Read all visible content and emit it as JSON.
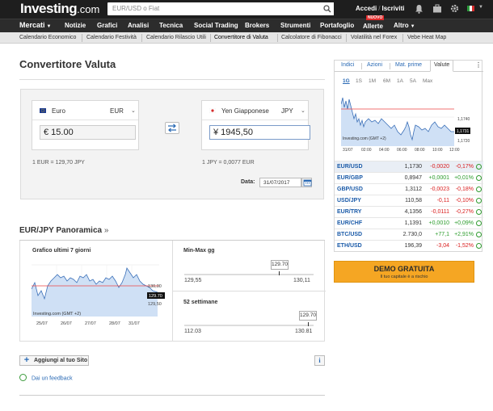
{
  "topbar": {
    "logo_main": "Investing",
    "logo_suffix": ".com",
    "search_placeholder": "EUR/USD o Fiat",
    "login": "Accedi",
    "separator": "/",
    "signup": "Iscriviti"
  },
  "nav": {
    "items": [
      "Mercati",
      "Notizie",
      "Grafici",
      "Analisi",
      "Tecnica",
      "Social Trading",
      "Brokers",
      "Strumenti",
      "Portafoglio",
      "Allerte",
      "Altro"
    ],
    "new_badge": "NUOVO"
  },
  "subnav": {
    "items": [
      "Calendario Economico",
      "Calendario Festività",
      "Calendario Rilascio Utili",
      "Convertitore di Valuta",
      "Calcolatore di Fibonacci",
      "Volatilità nel Forex",
      "Vebe Heat Map"
    ]
  },
  "converter": {
    "title": "Convertitore Valuta",
    "from": {
      "name": "Euro",
      "code": "EUR",
      "value": "€ 15.00",
      "rate": "1 EUR = 129,70 JPY"
    },
    "to": {
      "name": "Yen Giapponese",
      "code": "JPY",
      "value": "¥ 1945,50",
      "rate": "1 JPY = 0,0077 EUR"
    },
    "date_label": "Data:",
    "date_value": "31/07/2017"
  },
  "panoramica": {
    "title": "EUR/JPY Panoramica",
    "arrow": "»",
    "chart_label": "Grafico ultimi 7 giorni",
    "chart_source": "Investing.com (GMT +2)",
    "chart_y_labels": [
      "130,00",
      "129,70",
      "129,50"
    ],
    "chart_x_labels": [
      "25/07",
      "26/07",
      "27/07",
      "28/07",
      "31/07"
    ],
    "current_badge": "129.70",
    "minmax_label": "Min-Max gg",
    "minmax_current": "129.70",
    "minmax_low": "129,55",
    "minmax_high": "130,11",
    "week52_label": "52 settimane",
    "week52_current": "129.70",
    "week52_low": "112.03",
    "week52_high": "130.81"
  },
  "actions": {
    "add_site": "Aggiungi al tuo Sito",
    "info": "i",
    "feedback": "Dai un feedback"
  },
  "sidebar": {
    "tabs": [
      "Indici",
      "Azioni",
      "Mat. prime",
      "Valute"
    ],
    "periods": [
      "1G",
      "1S",
      "1M",
      "6M",
      "1A",
      "5A",
      "Max"
    ],
    "chart_source": "Investing.com (GMT +2)",
    "chart_y_labels": [
      "1,1740",
      "1,1731",
      "1,1720"
    ],
    "chart_x_labels": [
      "31/07",
      "02:00",
      "04:00",
      "06:00",
      "08:00",
      "10:00",
      "12:00"
    ],
    "quotes": [
      {
        "pair": "EUR/USD",
        "price": "1,1730",
        "change": "-0,0020",
        "pct": "-0,17%",
        "dir": "neg"
      },
      {
        "pair": "EUR/GBP",
        "price": "0,8947",
        "change": "+0,0001",
        "pct": "+0,01%",
        "dir": "pos"
      },
      {
        "pair": "GBP/USD",
        "price": "1,3112",
        "change": "-0,0023",
        "pct": "-0,18%",
        "dir": "neg"
      },
      {
        "pair": "USD/JPY",
        "price": "110,58",
        "change": "-0,11",
        "pct": "-0,10%",
        "dir": "neg"
      },
      {
        "pair": "EUR/TRY",
        "price": "4,1356",
        "change": "-0,0111",
        "pct": "-0,27%",
        "dir": "neg"
      },
      {
        "pair": "EUR/CHF",
        "price": "1,1391",
        "change": "+0,0010",
        "pct": "+0,09%",
        "dir": "pos"
      },
      {
        "pair": "BTC/USD",
        "price": "2.730,0",
        "change": "+77,1",
        "pct": "+2,91%",
        "dir": "pos"
      },
      {
        "pair": "ETH/USD",
        "price": "196,39",
        "change": "-3,04",
        "pct": "-1,52%",
        "dir": "neg"
      }
    ],
    "demo_title": "DEMO GRATUITA",
    "demo_sub": "Il tuo capitale è a rischio"
  },
  "colors": {
    "topbar": "#1e1e1e",
    "link": "#2a6ab5",
    "negative": "#d91c1c",
    "positive": "#2a9b2a",
    "demo": "#f5a623"
  }
}
